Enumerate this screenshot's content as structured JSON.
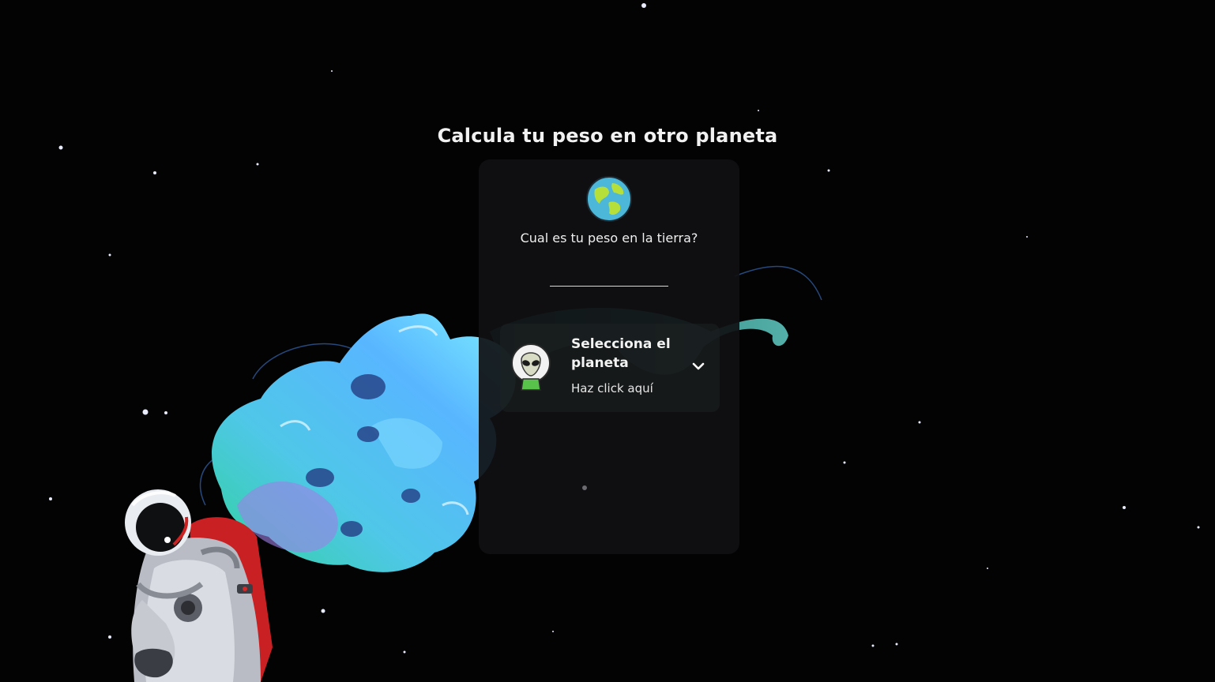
{
  "page": {
    "title": "Calcula tu peso en otro planeta",
    "background_color": "#030304"
  },
  "form": {
    "earth_icon": "earth-globe-icon",
    "question": "Cual es tu peso en la tierra?",
    "weight_input": {
      "value": "",
      "placeholder": ""
    }
  },
  "planet_selector": {
    "icon": "alien-avatar-icon",
    "title": "Selecciona el planeta",
    "subtitle": "Haz click aquí",
    "chevron_icon": "chevron-down-icon"
  },
  "illustration": {
    "subject": "astronaut-with-comet-icon",
    "colors": {
      "comet_primary": "#3ec9e6",
      "comet_secondary": "#9b7be0",
      "suit_accent": "#d42a2a"
    }
  }
}
